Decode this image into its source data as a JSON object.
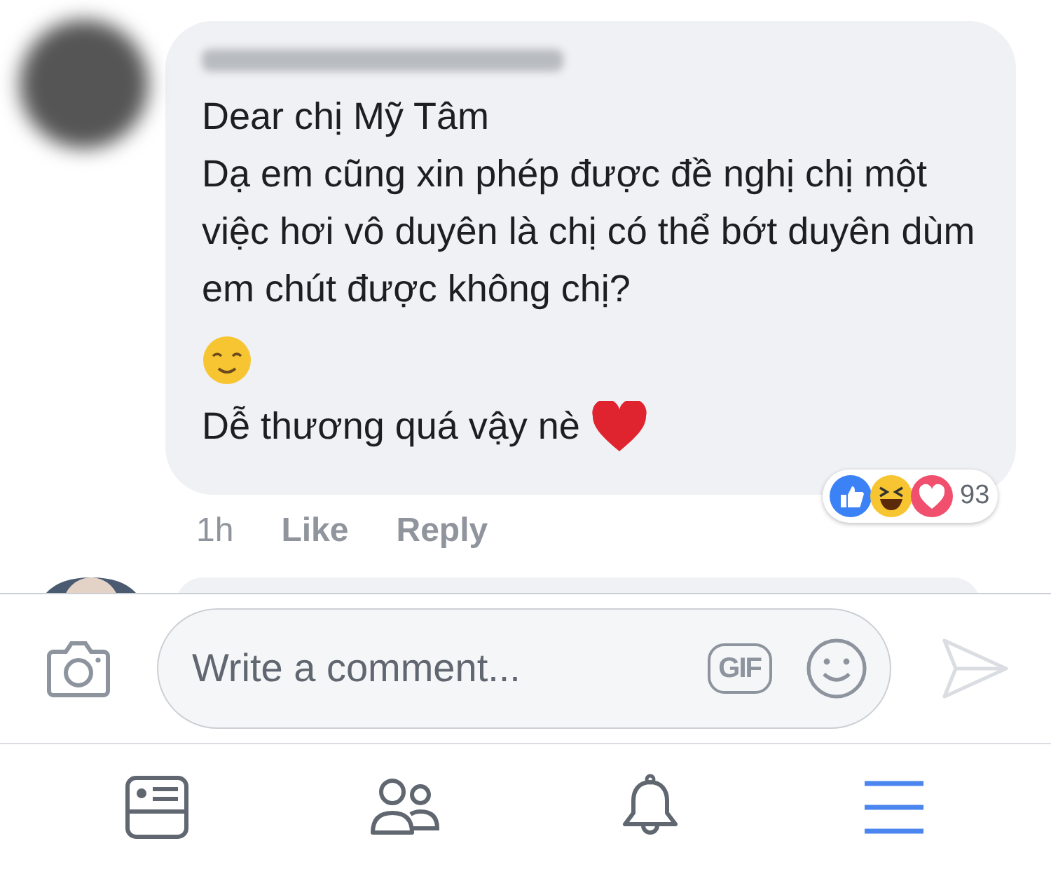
{
  "comment": {
    "lines": [
      "Dear chị Mỹ Tâm",
      "Dạ em cũng xin phép được đề nghị chị một việc hơi vô duyên là chị có thể bớt duyên dùm em chút được không chị?"
    ],
    "closing": "Dễ thương quá vậy nè",
    "time": "1h",
    "actions": [
      "Like",
      "Reply"
    ],
    "reactions": {
      "count": "93"
    }
  },
  "composer": {
    "placeholder": "Write a comment...",
    "gif_label": "GIF"
  },
  "tabs": [
    {
      "kind": "feed",
      "selected": false
    },
    {
      "kind": "friends",
      "selected": false
    },
    {
      "kind": "notifications",
      "selected": false
    },
    {
      "kind": "menu",
      "selected": true
    }
  ]
}
